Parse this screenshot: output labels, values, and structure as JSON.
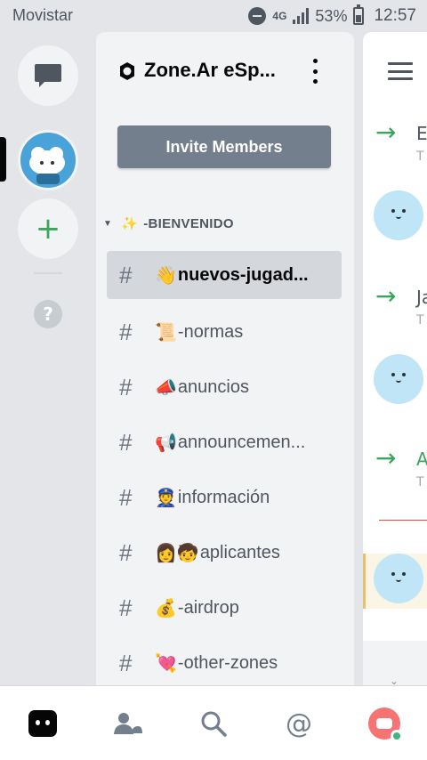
{
  "status_bar": {
    "carrier": "Movistar",
    "network": "4G",
    "battery": "53%",
    "time": "12:57",
    "icons": [
      "do-not-disturb-icon",
      "signal-icon",
      "battery-icon"
    ]
  },
  "server_rail": {
    "icons": [
      "direct-messages-icon",
      "server-avatar",
      "add-server-icon",
      "help-icon"
    ],
    "help_label": "?",
    "add_label": "+"
  },
  "server": {
    "name": "Zone.Ar eSp...",
    "invite_label": "Invite Members",
    "category": "-BIENVENIDO",
    "category_icon": "sparkles-icon",
    "channels": [
      {
        "emoji": "👋",
        "name": "nuevos-jugad...",
        "active": true
      },
      {
        "emoji": "📜",
        "name": "-normas",
        "active": false
      },
      {
        "emoji": "📣",
        "name": "anuncios",
        "active": false
      },
      {
        "emoji": "📢",
        "name": "announcemen...",
        "active": false
      },
      {
        "emoji": "👮",
        "name": "información",
        "active": false
      },
      {
        "emoji": "👩🧒",
        "name": "aplicantes",
        "active": false
      },
      {
        "emoji": "💰",
        "name": "-airdrop",
        "active": false
      },
      {
        "emoji": "💘",
        "name": "-other-zones",
        "active": false
      }
    ]
  },
  "chat_peek": {
    "messages": [
      {
        "type": "join",
        "letter": "E",
        "sub": "T"
      },
      {
        "type": "join",
        "letter": "Ja",
        "sub": "T"
      },
      {
        "type": "join",
        "letter": "A",
        "sub": "T"
      }
    ]
  },
  "bottom_nav": {
    "items": [
      "home-icon",
      "friends-icon",
      "search-icon",
      "mentions-icon",
      "profile-avatar"
    ]
  },
  "colors": {
    "accent_green": "#3ba55c",
    "invite_button": "#747f8d",
    "unread_line": "#f04747",
    "online": "#43b581"
  }
}
